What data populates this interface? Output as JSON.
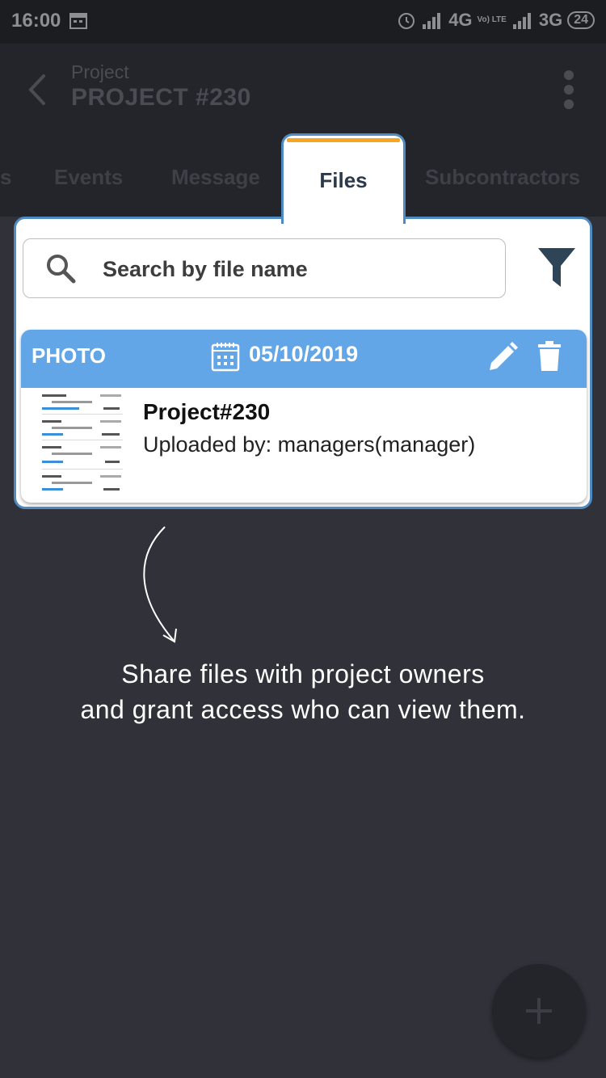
{
  "status_bar": {
    "time": "16:00",
    "network_1": "4G",
    "volte_label": "Vo) LTE",
    "network_2": "3G",
    "battery": "24"
  },
  "header": {
    "subtitle": "Project",
    "title": "PROJECT #230"
  },
  "tabs": {
    "left_partial": "s",
    "events": "Events",
    "message": "Message",
    "files": "Files",
    "subcontractors": "Subcontractors"
  },
  "search": {
    "placeholder": "Search by file name"
  },
  "file": {
    "type": "PHOTO",
    "date": "05/10/2019",
    "name": "Project#230",
    "uploaded_by": "Uploaded by: managers(manager)"
  },
  "caption": {
    "line1": "Share files with project owners",
    "line2": "and grant access who can view them."
  },
  "colors": {
    "accent_blue": "#62a6e8",
    "tab_indicator": "#f5a623",
    "highlight_border": "#4f8ac0"
  }
}
